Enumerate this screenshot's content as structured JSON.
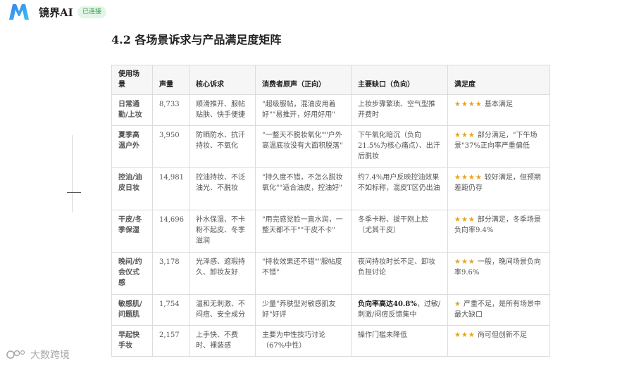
{
  "app": {
    "brand": "镜界AI",
    "status_badge": "已连接"
  },
  "section": {
    "title": "4.2 各场景诉求与产品满足度矩阵"
  },
  "table": {
    "headers": [
      "使用场景",
      "声量",
      "核心诉求",
      "消费者原声（正向）",
      "主要缺口（负向）",
      "满足度"
    ],
    "rows": [
      {
        "scene": "日常通勤/上妆",
        "volume": "8,733",
        "need": "顺滑推开、服帖贴肤、快手便捷",
        "voice": "\"超级服帖，混油皮用着好\"\"易推开，好用好用\"",
        "gap_bold": "",
        "gap": "上妆步骤繁琐、空气型推开费时",
        "stars": "★★★★",
        "rating": "基本满足"
      },
      {
        "scene": "夏季高温户外",
        "volume": "3,950",
        "need": "防晒防水、抗汗持妆、不氧化",
        "voice": "\"一整天不脱妆氧化\"\"户外高温底妆没有大面积脱落\"",
        "gap_bold": "",
        "gap": "下午氧化暗沉（负向21.5%为核心痛点）、出汗后脱妆",
        "stars": "★★★",
        "rating": "部分满足，\"下午场景\"37%正向率严重偏低"
      },
      {
        "scene": "控油/油皮日妆",
        "volume": "14,981",
        "need": "控油持妆、不泛油光、不脱妆",
        "voice": "\"持久度不错，不怎么脱妆氧化\"\"适合油皮，控油好\"",
        "gap_bold": "",
        "gap": "约7.4%用户反映控油效果不如标称，混皮T区仍出油",
        "stars": "★★★★",
        "rating": "较好满足，但预期差距仍存"
      },
      {
        "scene": "干皮/冬季保湿",
        "volume": "14,696",
        "need": "补水保湿、不卡粉不起皮、冬季滋润",
        "voice": "\"用完感觉脸一直水润，一整天都不干\"\"干皮不卡\"",
        "gap_bold": "",
        "gap": "冬季卡粉、拔干刚上脸（尤其干皮）",
        "stars": "★★★",
        "rating": "部分满足，冬季场景负向率9.4%"
      },
      {
        "scene": "晚间/约会仪式感",
        "volume": "3,178",
        "need": "光泽感、遮瑕持久、卸妆友好",
        "voice": "\"持妆效果还不错\"\"服帖度不错\"",
        "gap_bold": "",
        "gap": "夜间持妆时长不足、卸妆负担讨论",
        "stars": "★★★",
        "rating": "一般，晚间场景负向率9.6%"
      },
      {
        "scene": "敏感肌/问题肌",
        "volume": "1,754",
        "need": "温和无刺激、不闷痘、安全成分",
        "voice": "少量\"养肤型对敏感肌友好\"好评",
        "gap_bold": "负向率高达40.8%",
        "gap": "，过敏/刺激/闷痘反馈集中",
        "stars": "★",
        "rating": "严重不足，是所有场景中最大缺口"
      },
      {
        "scene": "早起快手妆",
        "volume": "2,157",
        "need": "上手快、不费时、裸装感",
        "voice": "主要为中性技巧讨论（67%中性）",
        "gap_bold": "",
        "gap": "操作门槛未降低",
        "stars": "★★★",
        "rating": "尚可但创新不足"
      }
    ]
  },
  "watermark": {
    "text": "大数跨境"
  }
}
